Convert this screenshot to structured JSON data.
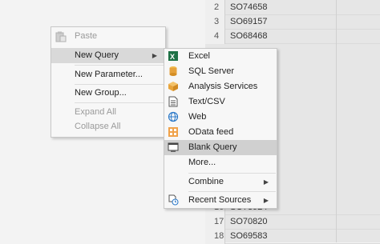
{
  "grid": {
    "rows": [
      {
        "num": "2",
        "value": "SO74658"
      },
      {
        "num": "3",
        "value": "SO69157"
      },
      {
        "num": "4",
        "value": "SO68468"
      },
      {
        "num": "16",
        "value": "SO73924"
      },
      {
        "num": "17",
        "value": "SO70820"
      },
      {
        "num": "18",
        "value": "SO69583"
      }
    ]
  },
  "context_menu": {
    "paste": "Paste",
    "new_query": "New Query",
    "new_parameter": "New Parameter...",
    "new_group": "New Group...",
    "expand_all": "Expand All",
    "collapse_all": "Collapse All"
  },
  "submenu": {
    "items": [
      {
        "label": "Excel",
        "icon": "excel-icon"
      },
      {
        "label": "SQL Server",
        "icon": "database-icon"
      },
      {
        "label": "Analysis Services",
        "icon": "cube-icon"
      },
      {
        "label": "Text/CSV",
        "icon": "document-icon"
      },
      {
        "label": "Web",
        "icon": "globe-icon"
      },
      {
        "label": "OData feed",
        "icon": "odata-icon"
      },
      {
        "label": "Blank Query",
        "icon": "blank-query-icon"
      },
      {
        "label": "More...",
        "icon": ""
      },
      {
        "label": "Combine",
        "icon": ""
      },
      {
        "label": "Recent Sources",
        "icon": "recent-sources-icon"
      }
    ]
  },
  "colors": {
    "excel": "#1e7145",
    "sql": "#e6a23c",
    "analysis": "#e8a43b",
    "odata": "#e07a1f",
    "globe": "#2a78c8"
  }
}
